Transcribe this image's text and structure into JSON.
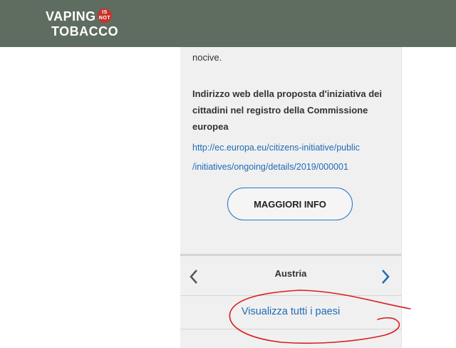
{
  "header": {
    "logo_vaping": "VAPING",
    "logo_is": "IS",
    "logo_not": "NOT",
    "logo_tobacco": "TOBACCO",
    "background_color": "#5e6d60"
  },
  "panel": {
    "trailing_text": "nocive.",
    "url_heading": "Indirizzo web della proposta d'iniziativa dei cittadini nel registro della Commissione europea",
    "url_line1": "http://ec.europa.eu/citizens-initiative/public",
    "url_line2": "/initiatives/ongoing/details/2019/000001",
    "more_button": "MAGGIORI INFO",
    "country": "Austria",
    "view_all": "Visualizza tutti i paesi"
  },
  "colors": {
    "link": "#1f6bb5",
    "annotation": "#d81f1f"
  }
}
